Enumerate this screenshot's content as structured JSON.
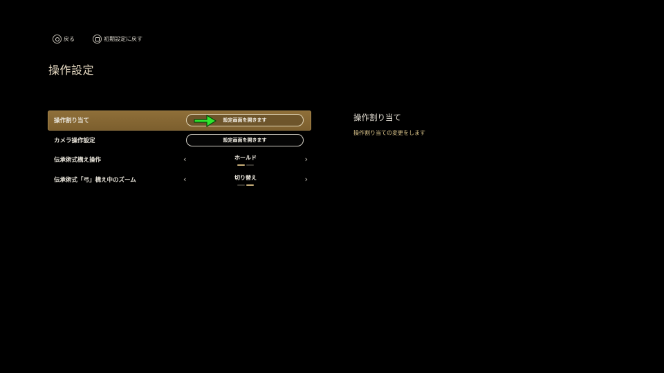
{
  "hints": [
    {
      "icon": "circle-button-icon",
      "label": "戻る"
    },
    {
      "icon": "square-button-icon",
      "label": "初期設定に戻す"
    }
  ],
  "page": {
    "title": "操作設定"
  },
  "settings": [
    {
      "label": "操作割り当て",
      "type": "button",
      "button_label": "設定画面を開きます",
      "selected": true
    },
    {
      "label": "カメラ操作設定",
      "type": "button",
      "button_label": "設定画面を開きます"
    },
    {
      "label": "伝承術式構え操作",
      "type": "selector",
      "value": "ホールド",
      "option_index": 0,
      "option_count": 2
    },
    {
      "label": "伝承術式「弓」構え中のズーム",
      "type": "selector",
      "value": "切り替え",
      "option_index": 1,
      "option_count": 2
    }
  ],
  "description": {
    "title": "操作割り当て",
    "text": "操作割り当ての変更をします"
  },
  "colors": {
    "selected_row": "#8f6f39",
    "arrow": "#2ee62e",
    "description_text": "#e0c98e"
  }
}
